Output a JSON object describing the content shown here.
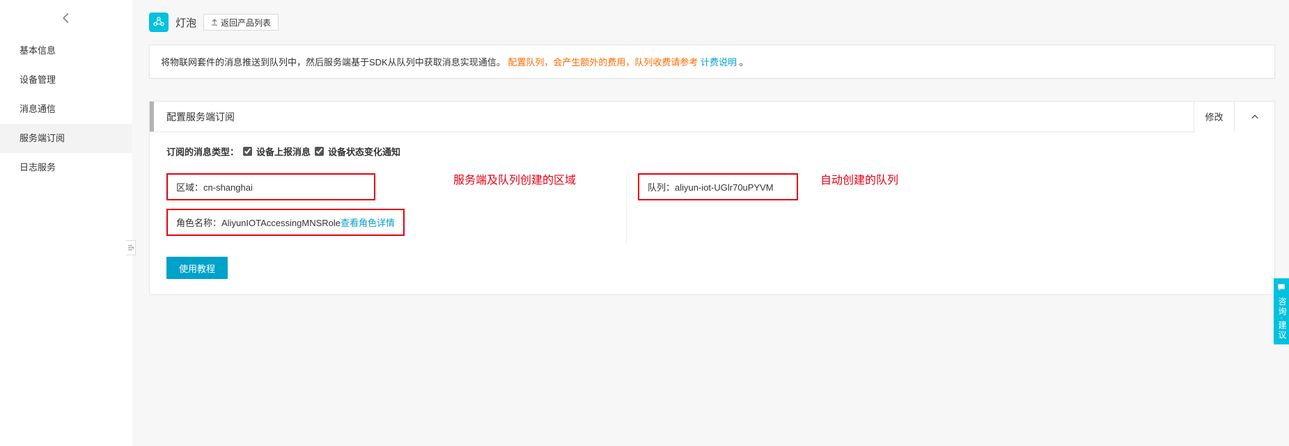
{
  "sidebar": {
    "items": [
      {
        "label": "基本信息"
      },
      {
        "label": "设备管理"
      },
      {
        "label": "消息通信"
      },
      {
        "label": "服务端订阅"
      },
      {
        "label": "日志服务"
      }
    ],
    "active_index": 3
  },
  "header": {
    "product_title": "灯泡",
    "back_to_list": "返回产品列表"
  },
  "banner": {
    "text_prefix": "将物联网套件的消息推送到队列中，然后服务端基于SDK从队列中获取消息实现通信。",
    "warn_text": "配置队列，会产生额外的费用，队列收费请参考",
    "link_text": "计费说明",
    "suffix": "。"
  },
  "panel": {
    "title": "配置服务端订阅",
    "modify_label": "修改",
    "subscribe": {
      "label": "订阅的消息类型：",
      "options": [
        {
          "label": "设备上报消息",
          "checked": true
        },
        {
          "label": "设备状态变化通知",
          "checked": true
        }
      ]
    },
    "region": {
      "label": "区域：",
      "value": "cn-shanghai"
    },
    "queue": {
      "label": "队列：",
      "value": "aliyun-iot-UGlr70uPYVM"
    },
    "role": {
      "label": "角色名称：",
      "value": "AliyunIOTAccessingMNSRole",
      "link": "查看角色详情"
    },
    "annotations": {
      "left": "服务端及队列创建的区域",
      "right": "自动创建的队列"
    },
    "tutorial_button": "使用教程"
  },
  "feedback": {
    "label": "咨询·建议"
  }
}
